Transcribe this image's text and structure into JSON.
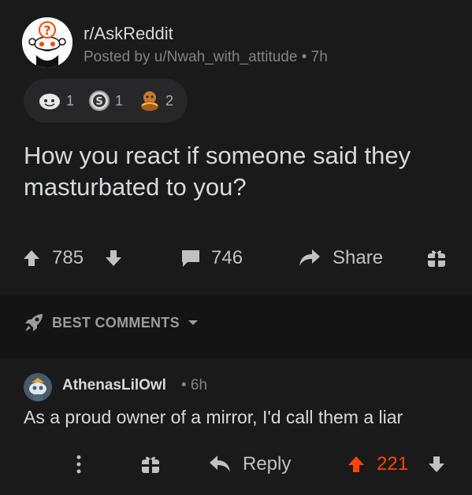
{
  "post": {
    "subreddit": "r/AskReddit",
    "meta": "Posted by u/Nwah_with_attitude • 7h",
    "awards": [
      {
        "icon": "wholesome-award-icon",
        "count": "1"
      },
      {
        "icon": "silver-award-icon",
        "count": "1"
      },
      {
        "icon": "hugz-award-icon",
        "count": "2"
      }
    ],
    "title": "How you react if someone said they masturbated to you?",
    "votes": "785",
    "comments": "746",
    "share_label": "Share"
  },
  "sort": {
    "label": "BEST COMMENTS"
  },
  "comment": {
    "author": "AthenasLilOwl",
    "time": "• 6h",
    "body": "As a proud owner of a mirror, I'd call them a liar",
    "reply_label": "Reply",
    "votes": "221"
  },
  "colors": {
    "background": "#141414",
    "card": "#1a1a1b",
    "text": "#d7dadc",
    "muted": "#818384",
    "upvote": "#ff4500"
  }
}
